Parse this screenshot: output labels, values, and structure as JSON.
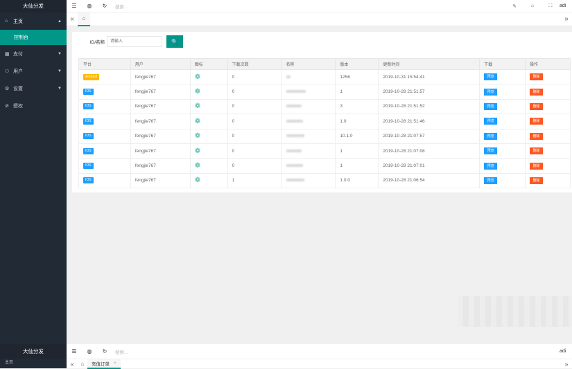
{
  "sidebar": {
    "title": "大仙分发",
    "items": [
      {
        "icon": "home-icon",
        "glyph": "⌂",
        "label": "主页",
        "caret": "▲"
      },
      {
        "icon": "calendar-icon",
        "glyph": "▦",
        "label": "支付",
        "caret": "▼"
      },
      {
        "icon": "user-icon",
        "glyph": "⚇",
        "label": "用户",
        "caret": "▼"
      },
      {
        "icon": "gear-icon",
        "glyph": "⚙",
        "label": "设置",
        "caret": "▼"
      },
      {
        "icon": "shield-icon",
        "glyph": "⊘",
        "label": "授权",
        "caret": ""
      }
    ],
    "sub_item": "控制台"
  },
  "topbar": {
    "menu_glyph": "☰",
    "globe_glyph": "◍",
    "refresh_glyph": "↻",
    "search_placeholder": "搜索...",
    "right_icons": [
      "✎",
      "⌂",
      "⛶"
    ],
    "user": "adi"
  },
  "tabs": {
    "left_arrow": "«",
    "home_glyph": "⌂",
    "right_arrow": "»"
  },
  "search": {
    "label": "ID/名称",
    "placeholder": "请输入",
    "button_glyph": "🔍"
  },
  "table": {
    "headers": [
      "平台",
      "用户",
      "图标",
      "下载次数",
      "名称",
      "版本",
      "更新时间",
      "下载",
      "操作"
    ],
    "rows": [
      {
        "platform": "Android",
        "user": "fengjie767",
        "downloads": "0",
        "version": "1256",
        "time": "2019-10-31 15:54:41"
      },
      {
        "platform": "IOS",
        "user": "fengjie767",
        "downloads": "0",
        "version": "1",
        "time": "2019-10-28 21:51:57"
      },
      {
        "platform": "IOS",
        "user": "fengjie767",
        "downloads": "0",
        "version": "3",
        "time": "2019-10-28 21:51:52"
      },
      {
        "platform": "IOS",
        "user": "fengjie767",
        "downloads": "0",
        "version": "1.0",
        "time": "2019-10-28 21:51:46"
      },
      {
        "platform": "IOS",
        "user": "fengjie767",
        "downloads": "0",
        "version": "10.1.0",
        "time": "2019-10-28 21:07:57"
      },
      {
        "platform": "IOS",
        "user": "fengjie767",
        "downloads": "0",
        "version": "1",
        "time": "2019-10-28 21:07:08"
      },
      {
        "platform": "IOS",
        "user": "fengjie767",
        "downloads": "0",
        "version": "1",
        "time": "2019-10-28 21:07:01"
      },
      {
        "platform": "IOS",
        "user": "fengjie767",
        "downloads": "1",
        "version": "1.0.0",
        "time": "2019-10-28 21:06:54"
      }
    ],
    "download_label": "预览",
    "delete_label": "删除",
    "icon_glyph": "❁"
  },
  "second": {
    "title": "大仙分发",
    "peek_item": "主页",
    "search_placeholder": "搜索...",
    "tab_label": "充值订单",
    "tab_close": "×",
    "user": "adi"
  },
  "colors": {
    "sidebar": "#222a35",
    "accent": "#009688",
    "blue": "#1e9fff",
    "red": "#ff5722",
    "android": "#ffb800"
  }
}
